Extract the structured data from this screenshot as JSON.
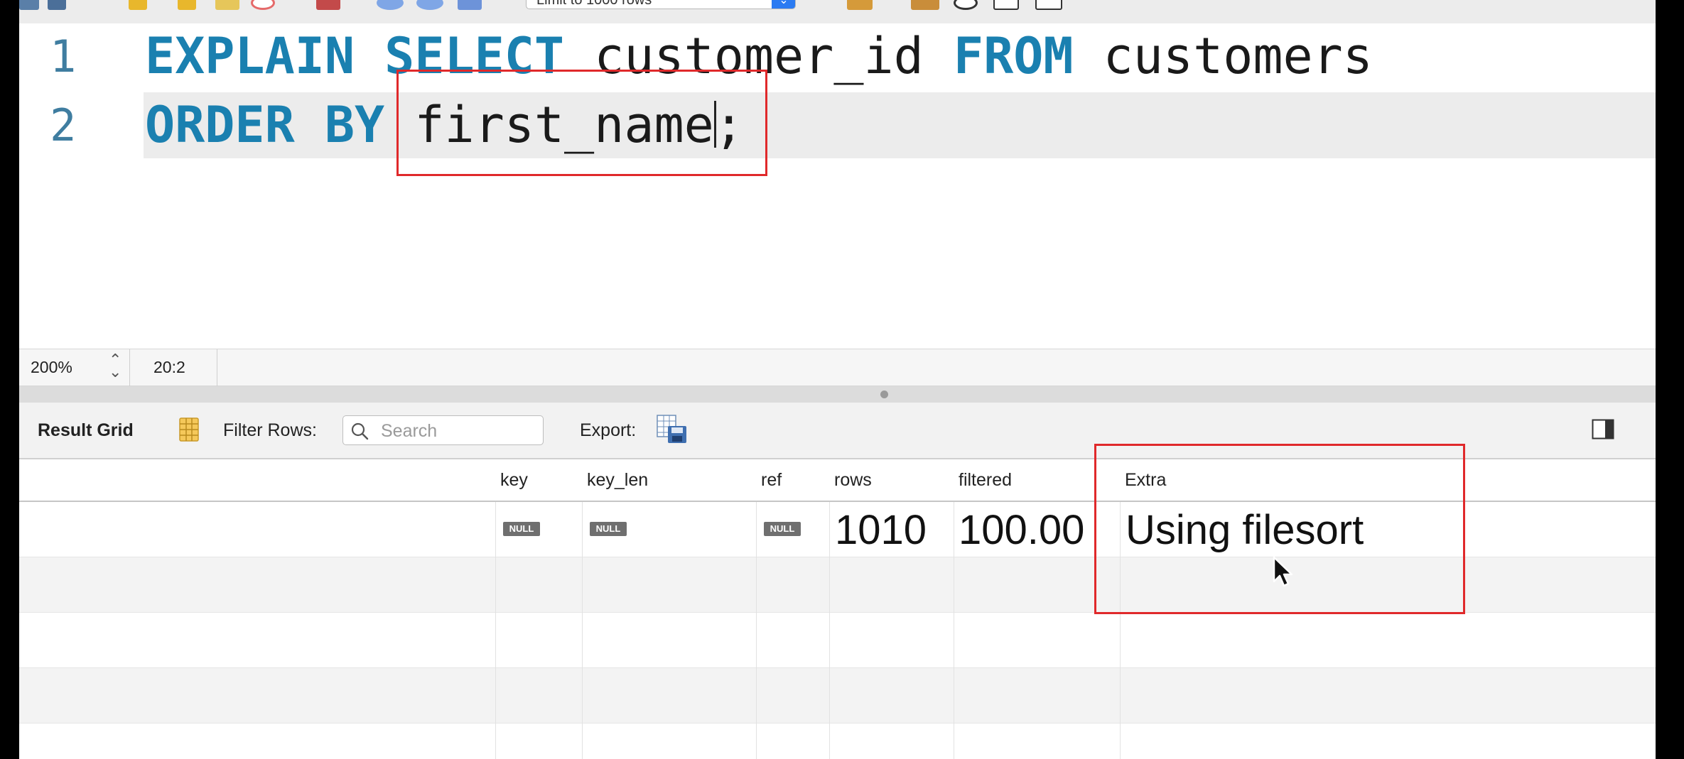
{
  "toolbar": {
    "limit_select_value": "Limit to 1000 rows"
  },
  "editor": {
    "line1": {
      "number": "1",
      "tokens": [
        {
          "text": "EXPLAIN",
          "kw": true
        },
        {
          "text": " ",
          "kw": false
        },
        {
          "text": "SELECT",
          "kw": true
        },
        {
          "text": " customer_id ",
          "kw": false
        },
        {
          "text": "FROM",
          "kw": true
        },
        {
          "text": " customers",
          "kw": false
        }
      ]
    },
    "line2": {
      "number": "2",
      "keyword": "ORDER BY",
      "ident": "first_name",
      "terminator": ";"
    }
  },
  "status": {
    "zoom": "200%",
    "cursor_position": "20:2"
  },
  "result_toolbar": {
    "result_grid_label": "Result Grid",
    "filter_rows_label": "Filter Rows:",
    "search_placeholder": "Search",
    "export_label": "Export:"
  },
  "grid": {
    "columns": [
      "key",
      "key_len",
      "ref",
      "rows",
      "filtered",
      "Extra"
    ],
    "row1": {
      "key": "NULL",
      "key_len": "NULL",
      "ref": "NULL",
      "rows": "1010",
      "filtered": "100.00",
      "extra": "Using filesort"
    }
  },
  "colors": {
    "keyword": "#1a80b0",
    "line_number": "#3f7da0",
    "annotation_box": "#e0292b",
    "null_badge": "#6f6f6f"
  }
}
